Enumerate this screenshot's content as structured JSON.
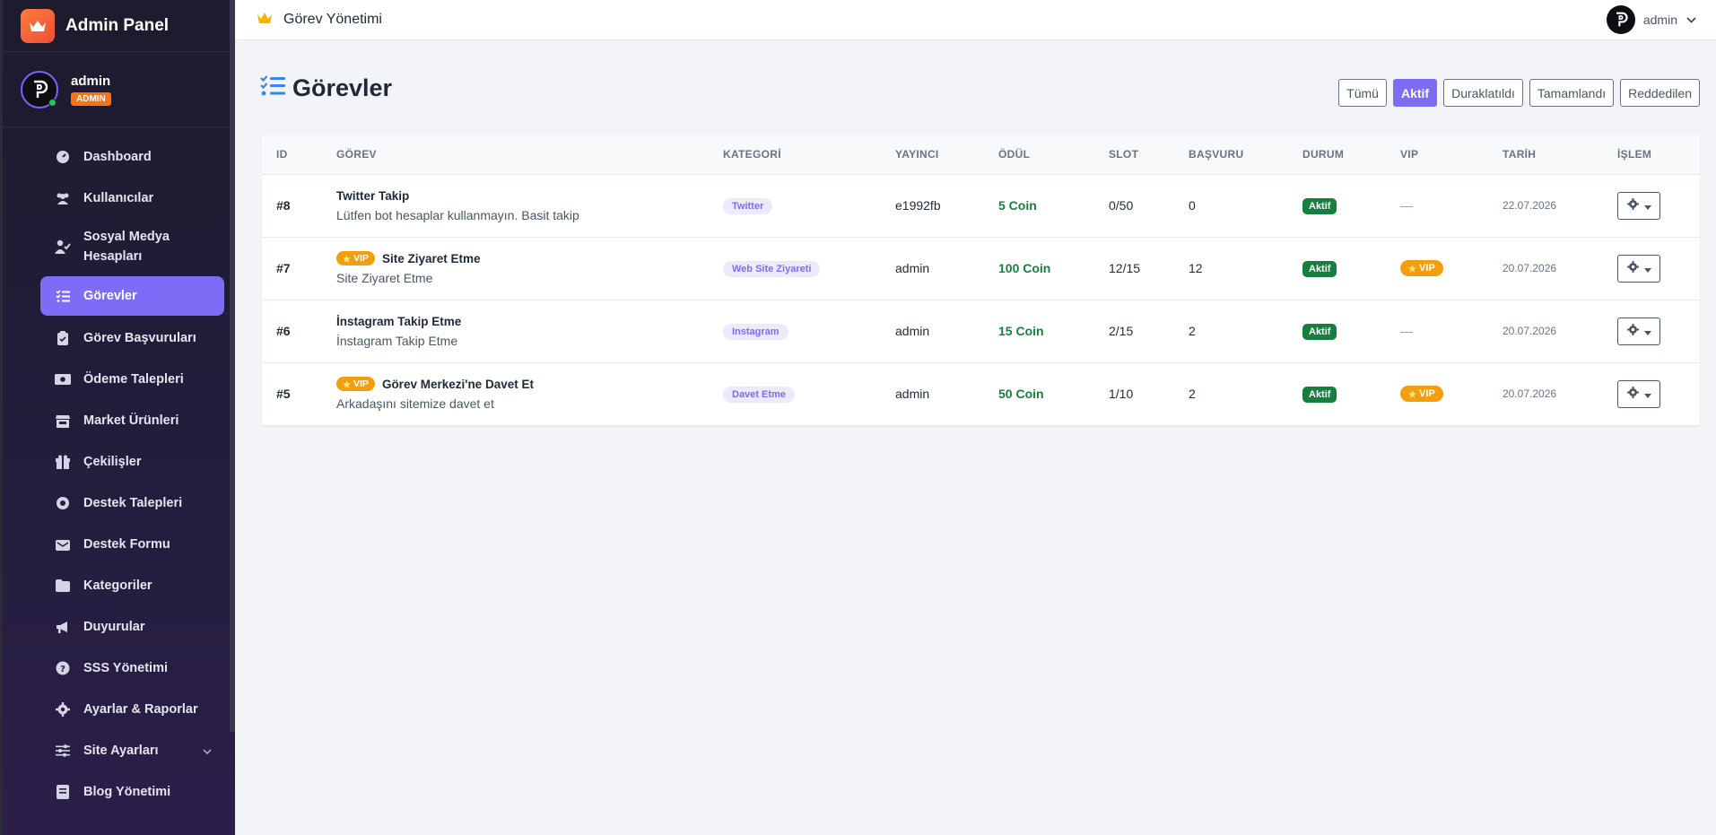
{
  "sidebar": {
    "brand": "Admin Panel",
    "user": {
      "name": "admin",
      "role": "ADMIN"
    },
    "items": [
      {
        "label": "Dashboard",
        "icon": "gauge-icon"
      },
      {
        "label": "Kullanıcılar",
        "icon": "users-icon"
      },
      {
        "label": "Sosyal Medya Hesapları",
        "icon": "user-check-icon"
      },
      {
        "label": "Görevler",
        "icon": "tasks-icon",
        "active": true
      },
      {
        "label": "Görev Başvuruları",
        "icon": "clipboard-icon"
      },
      {
        "label": "Ödeme Talepleri",
        "icon": "money-icon"
      },
      {
        "label": "Market Ürünleri",
        "icon": "store-icon"
      },
      {
        "label": "Çekilişler",
        "icon": "gift-icon"
      },
      {
        "label": "Destek Talepleri",
        "icon": "headset-icon"
      },
      {
        "label": "Destek Formu",
        "icon": "envelope-icon"
      },
      {
        "label": "Kategoriler",
        "icon": "folder-icon"
      },
      {
        "label": "Duyurular",
        "icon": "megaphone-icon"
      },
      {
        "label": "SSS Yönetimi",
        "icon": "question-icon"
      },
      {
        "label": "Ayarlar & Raporlar",
        "icon": "gear-icon"
      },
      {
        "label": "Site Ayarları",
        "icon": "sliders-icon",
        "has_submenu": true
      },
      {
        "label": "Blog Yönetimi",
        "icon": "blog-icon"
      }
    ]
  },
  "topbar": {
    "title": "Görev Yönetimi",
    "user": "admin"
  },
  "page": {
    "title": "Görevler",
    "filters": [
      {
        "label": "Tümü",
        "active": false
      },
      {
        "label": "Aktif",
        "active": true
      },
      {
        "label": "Duraklatıldı",
        "active": false
      },
      {
        "label": "Tamamlandı",
        "active": false
      },
      {
        "label": "Reddedilen",
        "active": false
      }
    ]
  },
  "table": {
    "headers": [
      "ID",
      "GÖREV",
      "KATEGORİ",
      "YAYINCI",
      "ÖDÜL",
      "SLOT",
      "BAŞVURU",
      "DURUM",
      "VIP",
      "TARİH",
      "İŞLEM"
    ],
    "rows": [
      {
        "id": "#8",
        "vip_badge": "",
        "title": "Twitter Takip",
        "desc": "Lütfen bot hesaplar kullanmayın. Basit takip",
        "category": "Twitter",
        "publisher": "e1992fb",
        "reward": "5 Coin",
        "slot": "0/50",
        "applications": "0",
        "status": "Aktif",
        "vip": "—",
        "date": "22.07.2026"
      },
      {
        "id": "#7",
        "vip_badge": "VIP",
        "title": "Site Ziyaret Etme",
        "desc": "Site Ziyaret Etme",
        "category": "Web Site Ziyareti",
        "publisher": "admin",
        "reward": "100 Coin",
        "slot": "12/15",
        "applications": "12",
        "status": "Aktif",
        "vip": "VIP",
        "date": "20.07.2026"
      },
      {
        "id": "#6",
        "vip_badge": "",
        "title": "İnstagram Takip Etme",
        "desc": "İnstagram Takip Etme",
        "category": "Instagram",
        "publisher": "admin",
        "reward": "15 Coin",
        "slot": "2/15",
        "applications": "2",
        "status": "Aktif",
        "vip": "—",
        "date": "20.07.2026"
      },
      {
        "id": "#5",
        "vip_badge": "VIP",
        "title": "Görev Merkezi'ne Davet Et",
        "desc": "Arkadaşını sitemize davet et",
        "category": "Davet Etme",
        "publisher": "admin",
        "reward": "50 Coin",
        "slot": "1/10",
        "applications": "2",
        "status": "Aktif",
        "vip": "VIP",
        "date": "20.07.2026"
      }
    ]
  },
  "colors": {
    "accent": "#7c6cf6",
    "success": "#15803d",
    "vip": "#f59e0b",
    "brand": "#f04e37"
  }
}
